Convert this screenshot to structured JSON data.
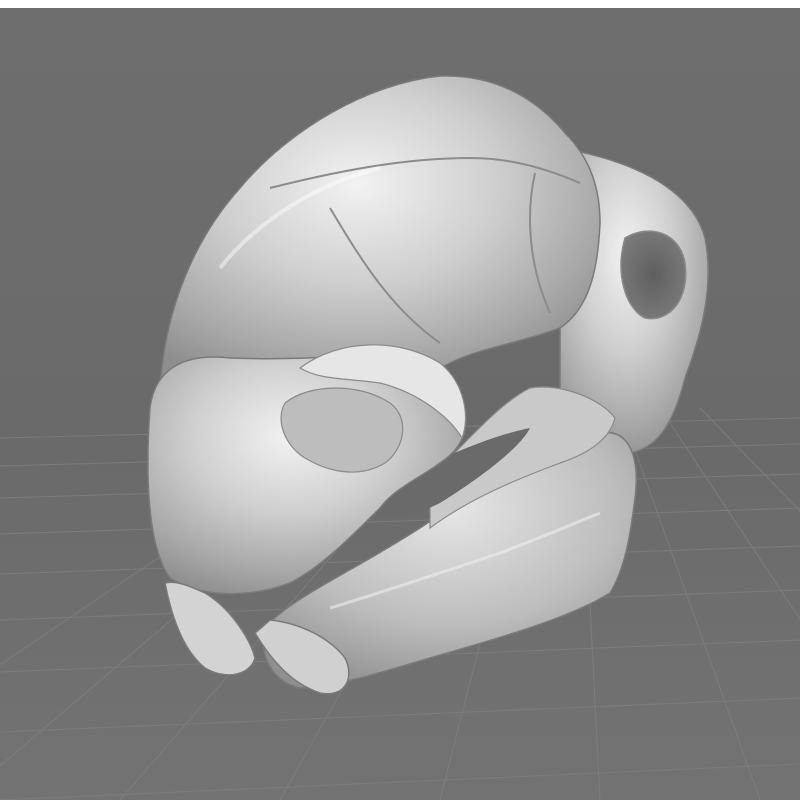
{
  "viewport": {
    "background_color": "#6c6c6c",
    "grid_color": "#7f7f7f",
    "model_color": "#d9d9d9",
    "model_shadow_color": "#8a8a8a",
    "model": "skull-3d-model",
    "ground_plane": "grid-floor"
  }
}
